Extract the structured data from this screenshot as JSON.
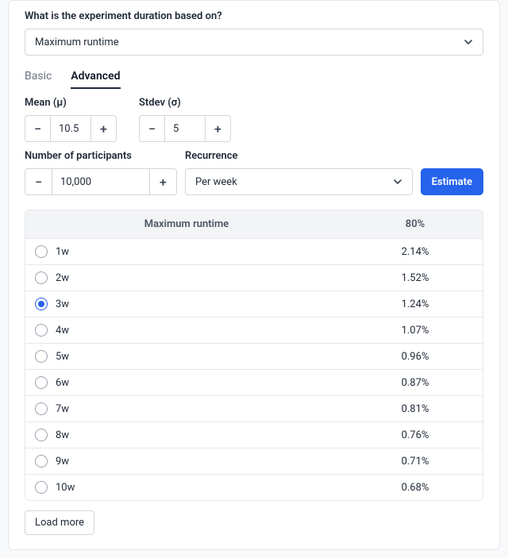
{
  "question": {
    "label": "What is the experiment duration based on?",
    "selected": "Maximum runtime"
  },
  "tabs": {
    "basic": "Basic",
    "advanced": "Advanced"
  },
  "mean": {
    "label": "Mean (μ)",
    "value": "10.5"
  },
  "stdev": {
    "label": "Stdev (σ)",
    "value": "5"
  },
  "participants": {
    "label": "Number of participants",
    "value": "10,000"
  },
  "recurrence": {
    "label": "Recurrence",
    "selected": "Per week"
  },
  "estimate_label": "Estimate",
  "table": {
    "col1": "Maximum runtime",
    "col2": "80%",
    "rows": [
      {
        "label": "1w",
        "pct": "2.14%",
        "selected": false
      },
      {
        "label": "2w",
        "pct": "1.52%",
        "selected": false
      },
      {
        "label": "3w",
        "pct": "1.24%",
        "selected": true
      },
      {
        "label": "4w",
        "pct": "1.07%",
        "selected": false
      },
      {
        "label": "5w",
        "pct": "0.96%",
        "selected": false
      },
      {
        "label": "6w",
        "pct": "0.87%",
        "selected": false
      },
      {
        "label": "7w",
        "pct": "0.81%",
        "selected": false
      },
      {
        "label": "8w",
        "pct": "0.76%",
        "selected": false
      },
      {
        "label": "9w",
        "pct": "0.71%",
        "selected": false
      },
      {
        "label": "10w",
        "pct": "0.68%",
        "selected": false
      }
    ]
  },
  "load_more": "Load more",
  "glyphs": {
    "minus": "−",
    "plus": "+"
  }
}
